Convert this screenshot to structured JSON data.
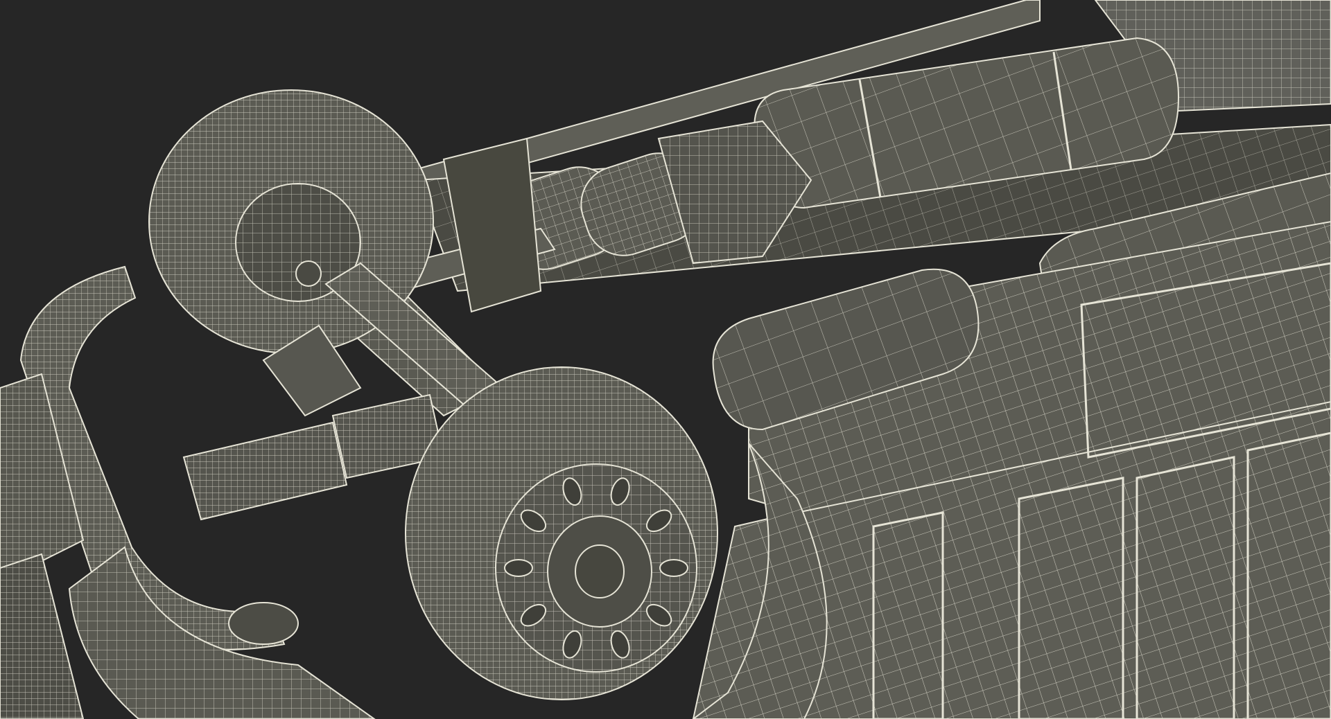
{
  "scene": {
    "subject": "truck-undercarriage-wireframe-render",
    "colors": {
      "background": "#262626",
      "surface": "#5b5b53",
      "surface_dark": "#46463f",
      "surface_light": "#6c6c63",
      "wire": "#e6e4d6",
      "wire_dim": "#bdbbae"
    }
  }
}
